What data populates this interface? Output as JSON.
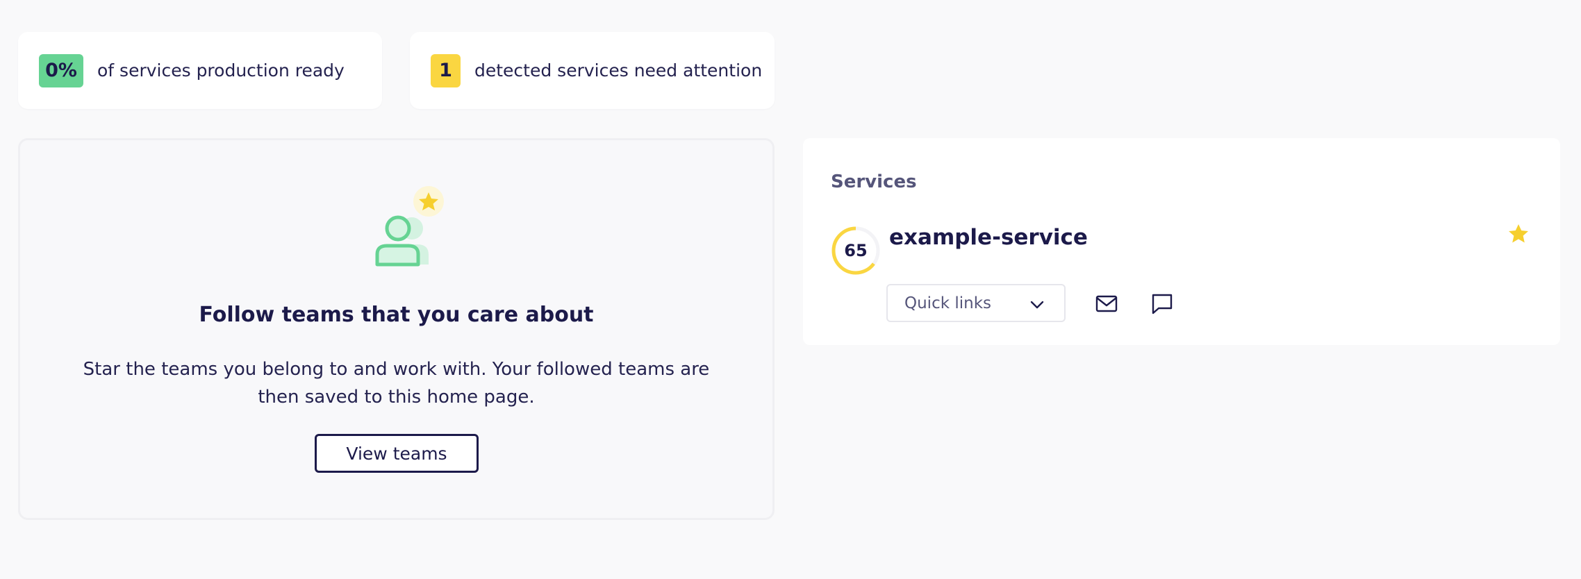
{
  "stats": {
    "production_ready": {
      "badge": "0%",
      "text": "of services production ready",
      "color": "#66d393"
    },
    "attention": {
      "badge": "1",
      "text": "detected services need attention",
      "color": "#fad641"
    }
  },
  "follow_teams": {
    "illustration_icon": "person-star-icon",
    "title": "Follow teams that you care about",
    "description": "Star the teams you belong to and work with. Your followed teams are then saved to this home page.",
    "button_label": "View teams"
  },
  "services": {
    "title": "Services",
    "items": [
      {
        "score": "65",
        "score_fraction": 0.65,
        "score_color": "#fad641",
        "name": "example-service",
        "favorited": true,
        "quick_links_label": "Quick links",
        "actions": [
          "mail-icon",
          "chat-icon"
        ]
      }
    ]
  },
  "colors": {
    "text_primary": "#1c1a4a",
    "text_muted": "#55557a",
    "accent_green": "#66d393",
    "accent_yellow": "#fad641",
    "background": "#f9f9fa"
  }
}
